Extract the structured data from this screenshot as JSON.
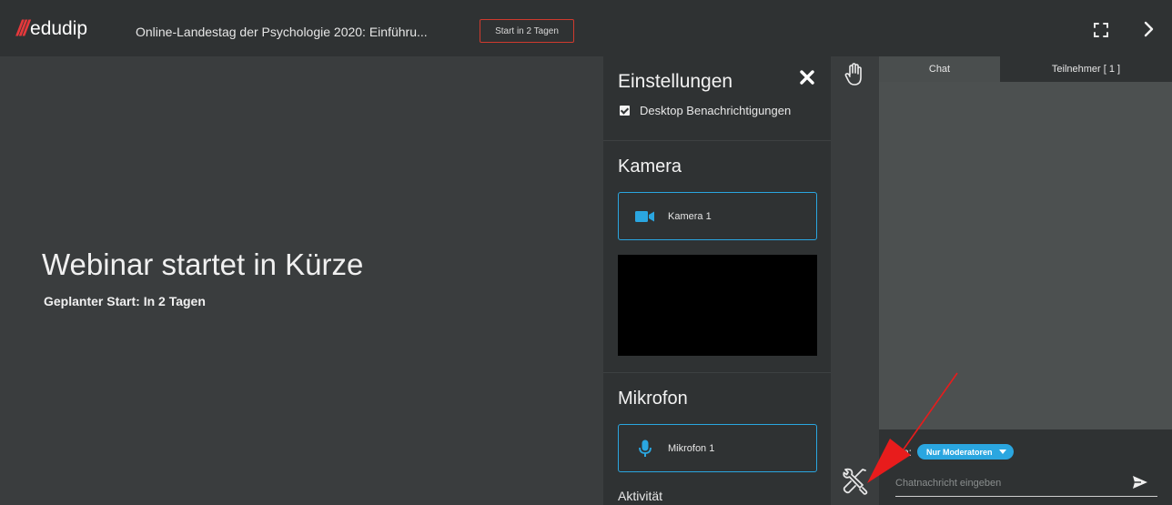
{
  "header": {
    "logo_slashes": "///",
    "logo_text": "edudip",
    "webinar_title": "Online-Landestag der Psychologie 2020: Einführu...",
    "start_badge": "Start in 2 Tagen"
  },
  "stage": {
    "title": "Webinar startet in Kürze",
    "subtitle": "Geplanter Start: In 2 Tagen"
  },
  "settings": {
    "title": "Einstellungen",
    "desktop_notifications": {
      "label": "Desktop Benachrichtigungen",
      "checked": true
    },
    "camera": {
      "title": "Kamera",
      "device": "Kamera 1"
    },
    "microphone": {
      "title": "Mikrofon",
      "device": "Mikrofon 1"
    },
    "activity_label": "Aktivität"
  },
  "chat": {
    "tabs": [
      {
        "label": "Chat",
        "active": true
      },
      {
        "label": "Teilnehmer [ 1 ]",
        "active": false
      }
    ],
    "to_label": "An:",
    "recipient": "Nur Moderatoren",
    "input_placeholder": "Chatnachricht eingeben"
  },
  "icons": {
    "fullscreen": "fullscreen-icon",
    "collapse": "chevron-right-icon",
    "close": "close-icon",
    "hand": "raise-hand-icon",
    "tools": "tools-icon",
    "camera": "camera-icon",
    "microphone": "microphone-icon",
    "send": "send-icon"
  },
  "colors": {
    "accent": "#2aa6e0",
    "brand": "#e5383b",
    "annotation_arrow": "#e81c1c"
  }
}
